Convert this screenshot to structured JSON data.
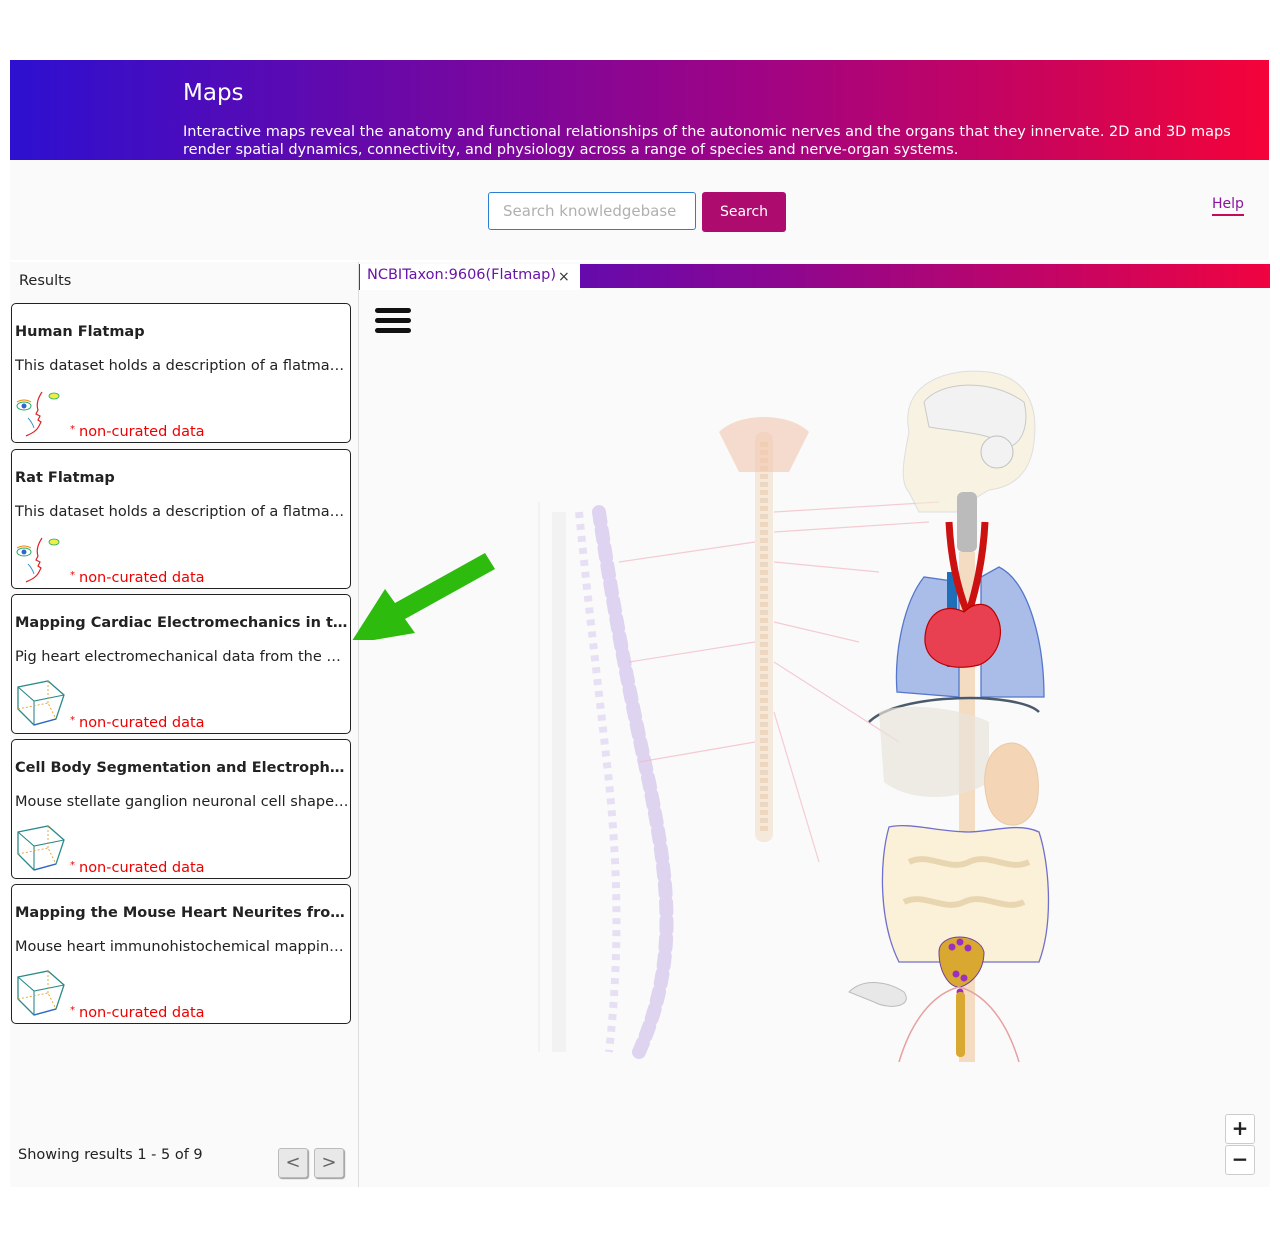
{
  "header": {
    "title": "Maps",
    "description": "Interactive maps reveal the anatomy and functional relationships of the autonomic nerves and the organs that they innervate. 2D and 3D maps render spatial dynamics, connectivity, and physiology across a range of species and nerve-organ systems."
  },
  "search": {
    "placeholder": "Search knowledgebase ...",
    "button_label": "Search",
    "help_label": "Help"
  },
  "sidebar": {
    "title": "Results",
    "cards": [
      {
        "title": "Human Flatmap",
        "description": "This dataset holds a description of a flatmap r...",
        "thumb": "face-flatmap-icon",
        "tag": "non-curated data"
      },
      {
        "title": "Rat Flatmap",
        "description": "This dataset holds a description of a flatmap r...",
        "thumb": "face-flatmap-icon",
        "tag": "non-curated data"
      },
      {
        "title": "Mapping Cardiac Electromechanics in the Pig",
        "description": "Pig heart electromechanical data from the Shi...",
        "thumb": "cube-scaffold-icon",
        "tag": "non-curated data"
      },
      {
        "title": "Cell Body Segmentation and Electrophysiolog...",
        "description": "Mouse stellate ganglion neuronal cell shape ...",
        "thumb": "cube-scaffold-icon",
        "tag": "non-curated data"
      },
      {
        "title": "Mapping the Mouse Heart Neurites from Imag...",
        "description": "Mouse heart immunohistochemical mapping ...",
        "thumb": "cube-scaffold-icon",
        "tag": "non-curated data"
      }
    ],
    "showing": "Showing results 1 - 5 of 9",
    "prev_label": "<",
    "next_label": ">"
  },
  "map": {
    "tab_label": "NCBITaxon:9606(Flatmap)",
    "tab_close": "×",
    "zoom_in": "+",
    "zoom_out": "−"
  },
  "colors": {
    "brand_magenta": "#ad0c6e",
    "tab_text": "#6a14a8",
    "curated_red": "#e00000",
    "annotation_arrow": "#2dbb0e"
  }
}
